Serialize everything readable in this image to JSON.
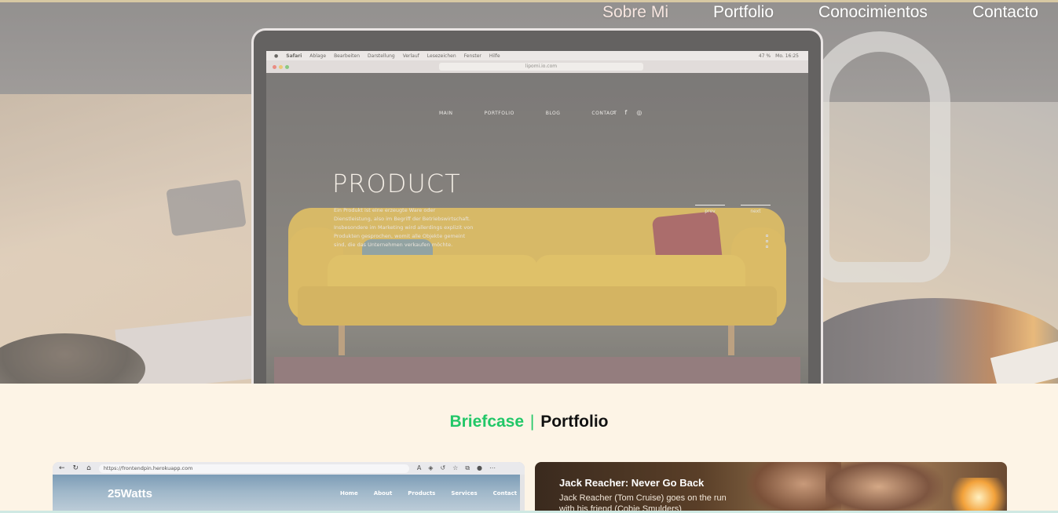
{
  "nav": {
    "items": [
      {
        "label": "Sobre Mi"
      },
      {
        "label": "Portfolio"
      },
      {
        "label": "Conocimientos"
      },
      {
        "label": "Contacto"
      }
    ]
  },
  "hero": {
    "screen": {
      "menubar": [
        "Safari",
        "Ablage",
        "Bearbeiten",
        "Darstellung",
        "Verlauf",
        "Lesezeichen",
        "Fenster",
        "Hilfe"
      ],
      "menubar_time": "Mo. 16:25",
      "menubar_battery": "47 %",
      "url": "lipomi.io.com",
      "site_nav": [
        "MAIN",
        "PORTFOLIO",
        "BLOG",
        "CONTACT"
      ],
      "product_title": "PRODUCT",
      "product_desc": "Ein Produkt ist eine erzeugte Ware oder Dienstleistung, also im Begriff der Betriebswirtschaft. Insbesondere im Marketing wird allerdings explizit von Produkten gesprochen, womit alle Objekte gemeint sind, die das Unternehmen verkaufen möchte.",
      "prev_label": "prev",
      "next_label": "next"
    },
    "colors": {
      "overlay": "#fdf4e6",
      "sofa": "#c9a236"
    }
  },
  "section": {
    "title_green": "Briefcase",
    "title_sep": "|",
    "title_black": "Portfolio"
  },
  "cards": {
    "left": {
      "url": "https://frontendpin.herokuapp.com",
      "logo": "25Watts",
      "nav": [
        "Home",
        "About",
        "Products",
        "Services",
        "Contact"
      ]
    },
    "right": {
      "title": "Jack Reacher: Never Go Back",
      "desc": "Jack Reacher (Tom Cruise) goes on the run with his friend (Cobie Smulders)"
    }
  },
  "colors": {
    "background": "#fdf4e6",
    "accent_green": "#22c768",
    "title_black": "#111111"
  }
}
